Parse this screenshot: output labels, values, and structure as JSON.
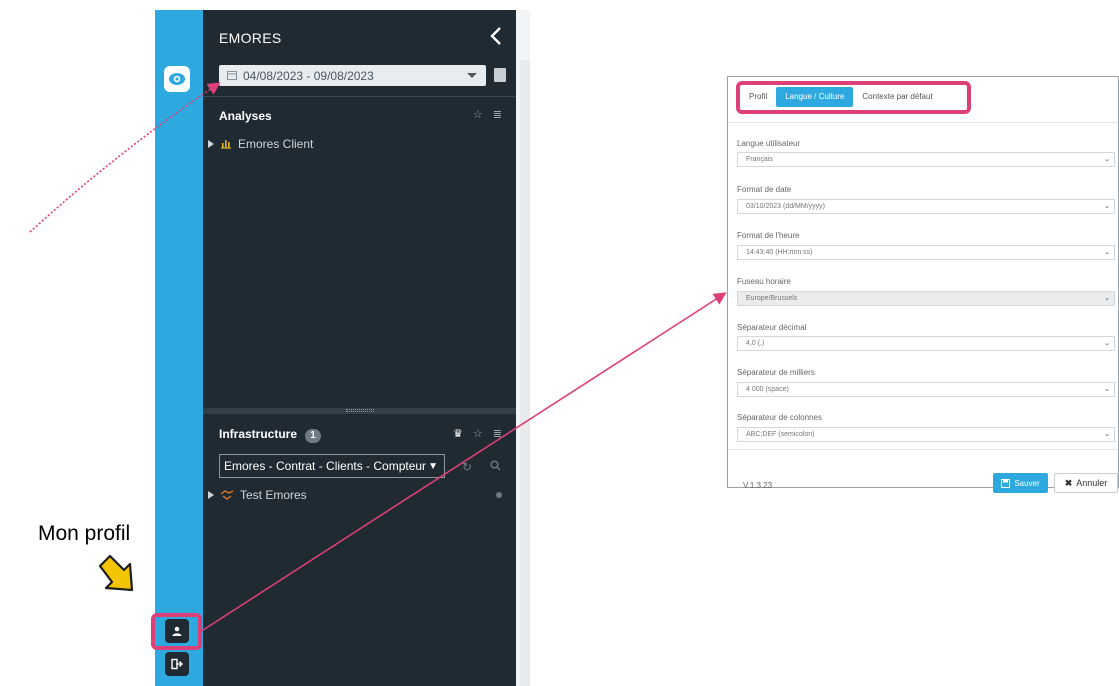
{
  "callout": {
    "label": "Mon profil"
  },
  "panel": {
    "title": "EMORES",
    "date_range": "04/08/2023 - 09/08/2023",
    "analyses": {
      "title": "Analyses",
      "items": [
        {
          "label": "Emores Client"
        }
      ]
    },
    "infrastructure": {
      "title": "Infrastructure",
      "count": "1",
      "selected_view": "Emores - Contrat - Clients - Compteur",
      "items": [
        {
          "label": "Test Emores"
        }
      ]
    }
  },
  "dialog": {
    "tabs": [
      {
        "label": "Profil",
        "active": false
      },
      {
        "label": "Langue / Culture",
        "active": true
      },
      {
        "label": "Contexte par défaut",
        "active": false
      }
    ],
    "fields": [
      {
        "label": "Langue utilisateur",
        "value": "Français",
        "disabled": false
      },
      {
        "label": "Format de date",
        "value": "03/10/2023 (dd/MM/yyyy)",
        "disabled": false
      },
      {
        "label": "Format de l'heure",
        "value": "14:43:40 (HH:mm:ss)",
        "disabled": false
      },
      {
        "label": "Fuseau horaire",
        "value": "Europe/Brussels",
        "disabled": true
      },
      {
        "label": "Séparateur décimal",
        "value": "4,0 (,)",
        "disabled": false
      },
      {
        "label": "Séparateur de milliers",
        "value": "4 000 (space)",
        "disabled": false
      },
      {
        "label": "Séparateur de colonnes",
        "value": "ABC;DEF (semicolon)",
        "disabled": false
      }
    ],
    "version": "V.1.3.23",
    "save_label": "Sauver",
    "cancel_label": "Annuler"
  },
  "colors": {
    "accent_blue": "#2ea9df",
    "panel_dark": "#1f2a33",
    "highlight_pink": "#dd3f78",
    "callout_yellow": "#f2c500"
  },
  "icons": [
    "eye-icon",
    "user-icon",
    "logout-icon",
    "calendar-icon",
    "star-icon",
    "list-icon",
    "bar-chart-icon",
    "trophy-icon",
    "refresh-icon",
    "search-icon",
    "handshake-icon",
    "floppy-icon",
    "close-icon",
    "chevron-left-icon"
  ]
}
